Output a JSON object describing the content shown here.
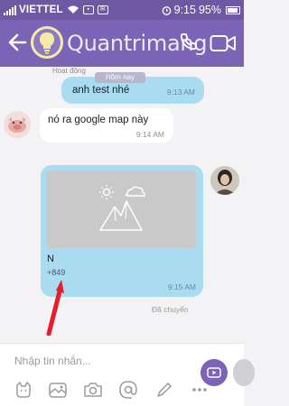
{
  "status_bar": {
    "carrier": "VIETTEL",
    "time": "9:15",
    "battery": "95%"
  },
  "header": {
    "watermark": "Quantrimang",
    "subtitle": "Hoạt động"
  },
  "chat": {
    "date_label": "Hôm nay",
    "messages": [
      {
        "direction": "out",
        "text": "anh test nhé",
        "time": "9:13 AM"
      },
      {
        "direction": "in",
        "text": "nó ra google map này",
        "time": "9:14 AM"
      },
      {
        "direction": "out",
        "type": "contact-card",
        "name": "N",
        "phone": "+849",
        "time": "9:15 AM"
      }
    ],
    "delivery_status": "Đã chuyển"
  },
  "composer": {
    "placeholder": "Nhập tin nhắn..."
  },
  "icons": {
    "back": "arrow-left-icon",
    "call": "phone-icon",
    "video": "video-camera-icon",
    "send": "send-icon",
    "sticker": "sticker-icon",
    "image": "image-icon",
    "camera": "camera-icon",
    "mention": "at-icon",
    "doodle": "doodle-icon",
    "more": "more-icon"
  },
  "colors": {
    "header": "#7b63b5",
    "outgoing_bubble": "#a9dcf1",
    "incoming_bubble": "#ffffff",
    "annotation_arrow": "#e81c2b"
  }
}
